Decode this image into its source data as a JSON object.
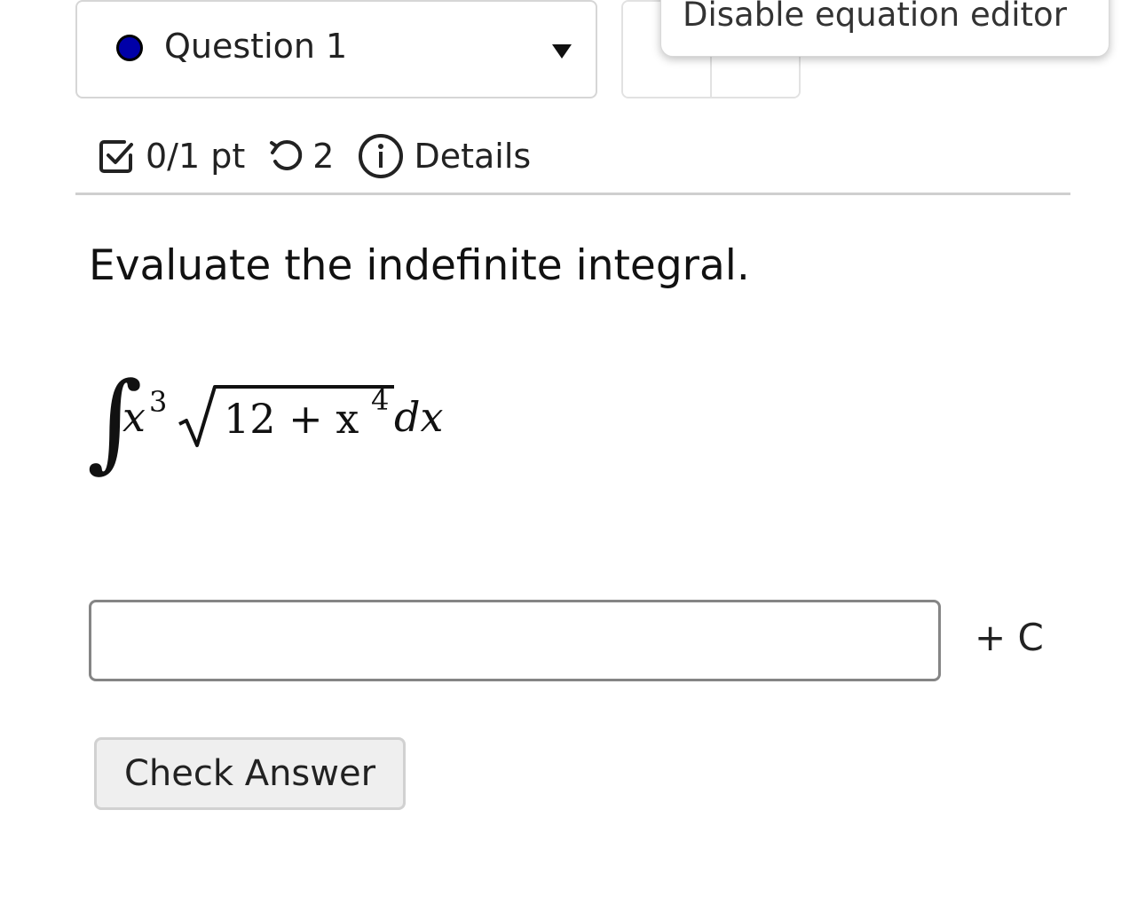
{
  "question_selector": {
    "label": "Question 1",
    "status_color": "#0000a8",
    "icon": "chevron-down-icon"
  },
  "tooltip": {
    "text": "Disable equation editor"
  },
  "meta": {
    "points": "0/1 pt",
    "attempts": "2",
    "details_label": "Details",
    "icons": [
      "checkbox-icon",
      "retry-icon",
      "info-icon"
    ]
  },
  "question": {
    "prompt": "Evaluate the indefinite integral.",
    "expression": "∫x³√(12 + x⁴)dx",
    "math": {
      "integral": "∫",
      "base_x": "x",
      "exp_3": "3",
      "radicand": "12 + x",
      "exp_4": "4",
      "differential": "dx"
    }
  },
  "answer": {
    "value": "",
    "placeholder": "",
    "suffix": "+ C"
  },
  "actions": {
    "check_answer_label": "Check Answer"
  }
}
